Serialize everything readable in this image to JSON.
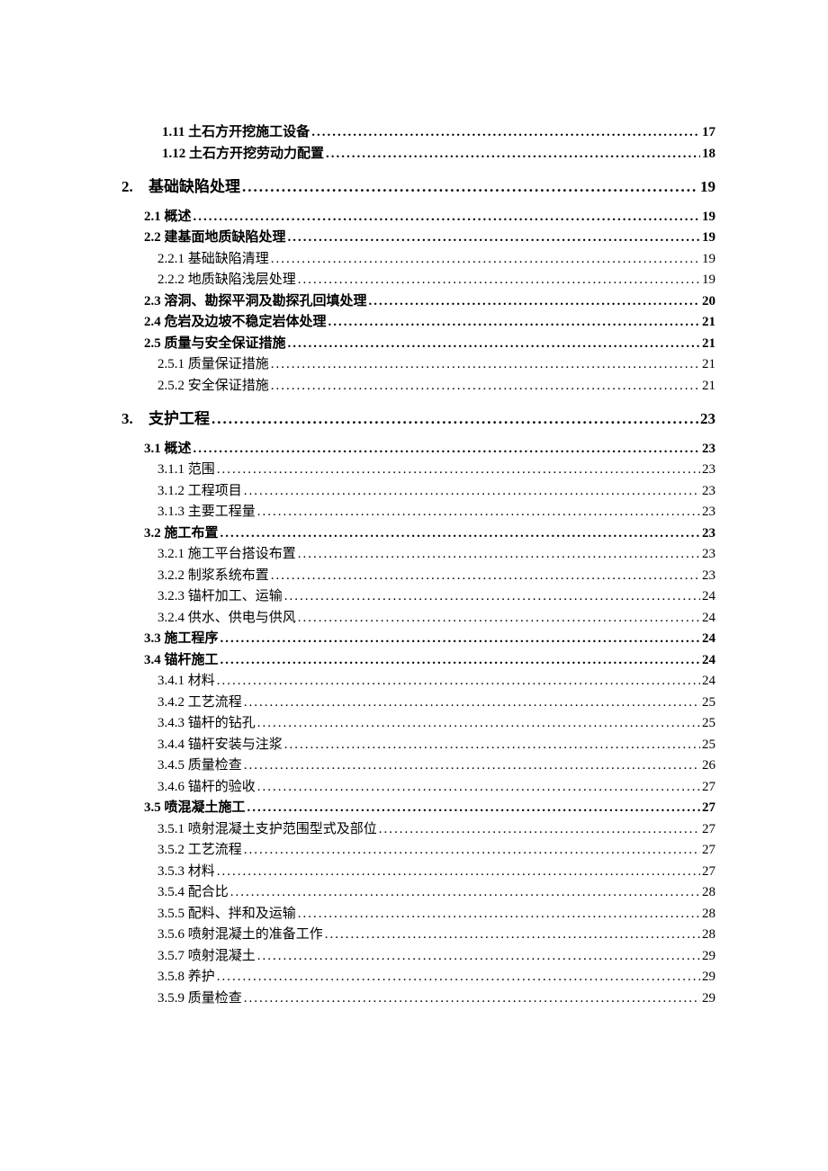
{
  "toc": [
    {
      "level": "lvl1",
      "label": "1.11 土石方开挖施工设备",
      "page": "17"
    },
    {
      "level": "lvl1",
      "label": "1.12 土石方开挖劳动力配置",
      "page": "18"
    },
    {
      "level": "chapter",
      "num": "2.",
      "label": "基础缺陷处理",
      "page": "19"
    },
    {
      "level": "lvl2",
      "label": "2.1 概述",
      "page": "19"
    },
    {
      "level": "lvl2",
      "label": "2.2 建基面地质缺陷处理",
      "page": "19"
    },
    {
      "level": "lvl3",
      "label": "2.2.1 基础缺陷清理",
      "page": "19"
    },
    {
      "level": "lvl3",
      "label": "2.2.2 地质缺陷浅层处理",
      "page": "19"
    },
    {
      "level": "lvl2",
      "label": "2.3 溶洞、勘探平洞及勘探孔回填处理",
      "page": "20"
    },
    {
      "level": "lvl2",
      "label": "2.4 危岩及边坡不稳定岩体处理",
      "page": "21"
    },
    {
      "level": "lvl2",
      "label": "2.5 质量与安全保证措施",
      "page": "21"
    },
    {
      "level": "lvl3",
      "label": "2.5.1 质量保证措施",
      "page": "21"
    },
    {
      "level": "lvl3",
      "label": "2.5.2 安全保证措施",
      "page": "21"
    },
    {
      "level": "chapter",
      "num": "3.",
      "label": "支护工程",
      "page": "23"
    },
    {
      "level": "lvl2",
      "label": "3.1 概述",
      "page": "23"
    },
    {
      "level": "lvl3",
      "label": "3.1.1 范围",
      "page": "23"
    },
    {
      "level": "lvl3",
      "label": "3.1.2 工程项目",
      "page": "23"
    },
    {
      "level": "lvl3",
      "label": "3.1.3 主要工程量",
      "page": "23"
    },
    {
      "level": "lvl2",
      "label": "3.2 施工布置",
      "page": "23"
    },
    {
      "level": "lvl3",
      "label": "3.2.1 施工平台搭设布置",
      "page": "23"
    },
    {
      "level": "lvl3",
      "label": "3.2.2 制浆系统布置",
      "page": "23"
    },
    {
      "level": "lvl3",
      "label": "3.2.3 锚杆加工、运输",
      "page": "24"
    },
    {
      "level": "lvl3",
      "label": "3.2.4 供水、供电与供风",
      "page": "24"
    },
    {
      "level": "lvl2",
      "label": "3.3 施工程序",
      "page": "24"
    },
    {
      "level": "lvl2",
      "label": "3.4 锚杆施工",
      "page": "24"
    },
    {
      "level": "lvl3",
      "label": "3.4.1 材料",
      "page": "24"
    },
    {
      "level": "lvl3",
      "label": "3.4.2 工艺流程",
      "page": "25"
    },
    {
      "level": "lvl3",
      "label": "3.4.3 锚杆的钻孔",
      "page": "25"
    },
    {
      "level": "lvl3",
      "label": "3.4.4 锚杆安装与注浆",
      "page": "25"
    },
    {
      "level": "lvl3",
      "label": "3.4.5 质量检查",
      "page": "26"
    },
    {
      "level": "lvl3",
      "label": "3.4.6 锚杆的验收",
      "page": "27"
    },
    {
      "level": "lvl2",
      "label": "3.5 喷混凝土施工",
      "page": "27"
    },
    {
      "level": "lvl3",
      "label": "3.5.1 喷射混凝土支护范围型式及部位",
      "page": "27"
    },
    {
      "level": "lvl3",
      "label": "3.5.2 工艺流程",
      "page": "27"
    },
    {
      "level": "lvl3",
      "label": "3.5.3 材料",
      "page": "27"
    },
    {
      "level": "lvl3",
      "label": "3.5.4 配合比",
      "page": "28"
    },
    {
      "level": "lvl3",
      "label": "3.5.5 配料、拌和及运输",
      "page": "28"
    },
    {
      "level": "lvl3",
      "label": "3.5.6 喷射混凝土的准备工作",
      "page": "28"
    },
    {
      "level": "lvl3",
      "label": "3.5.7 喷射混凝土",
      "page": "29"
    },
    {
      "level": "lvl3",
      "label": "3.5.8 养护",
      "page": "29"
    },
    {
      "level": "lvl3",
      "label": "3.5.9 质量检查",
      "page": "29"
    }
  ]
}
